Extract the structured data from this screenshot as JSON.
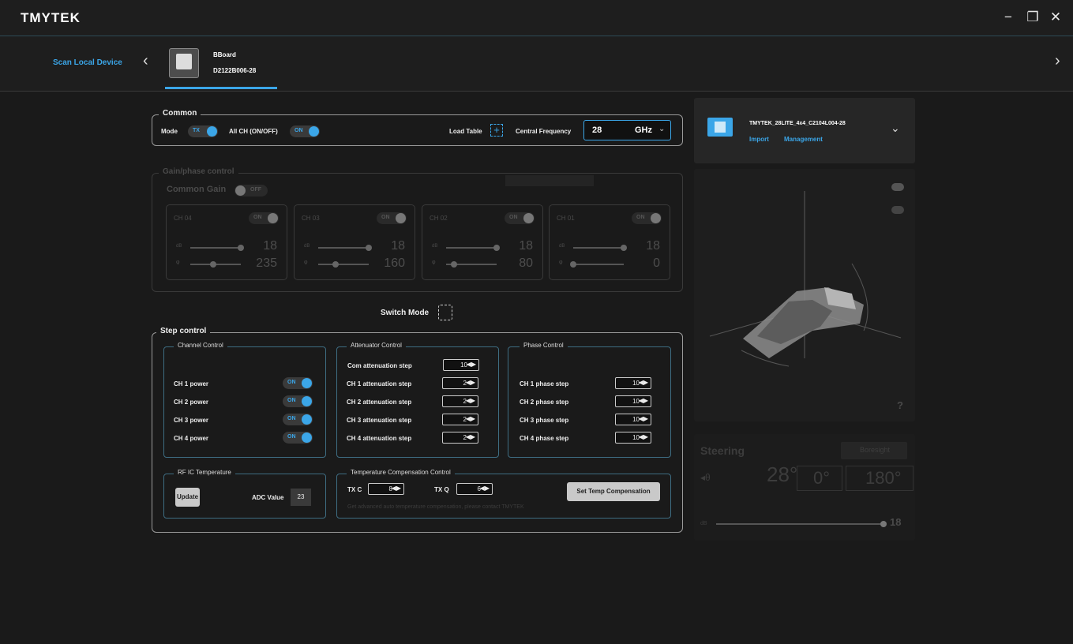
{
  "app": {
    "logo": "TMYTEK"
  },
  "window": {
    "minimize": "−",
    "restore": "❐",
    "close": "✕"
  },
  "devicebar": {
    "scan_label": "Scan Local Device",
    "device_name": "BBoard",
    "device_id": "D2122B006-28",
    "prev": "‹",
    "next": "›"
  },
  "common": {
    "legend": "Common",
    "mode_label": "Mode",
    "mode_value": "TX",
    "allch_label": "All CH (ON/OFF)",
    "allch_value": "ON",
    "load_table_label": "Load Table",
    "central_freq_label": "Central Frequency",
    "freq_value": "28",
    "freq_unit": "GHz"
  },
  "gainphase": {
    "legend": "Gain/phase control",
    "common_gain_label": "Common Gain",
    "common_gain_toggle": "OFF",
    "channels": [
      {
        "name": "CH 04",
        "toggle": "ON",
        "db_label": "dB",
        "db_value": "18",
        "phase_value": "235",
        "phase_level": 0.45
      },
      {
        "name": "CH 03",
        "toggle": "ON",
        "db_label": "dB",
        "db_value": "18",
        "phase_value": "160",
        "phase_level": 0.35
      },
      {
        "name": "CH 02",
        "toggle": "ON",
        "db_label": "dB",
        "db_value": "18",
        "phase_value": "80",
        "phase_level": 0.15
      },
      {
        "name": "CH 01",
        "toggle": "ON",
        "db_label": "dB",
        "db_value": "18",
        "phase_value": "0",
        "phase_level": 0.0
      }
    ]
  },
  "switch_mode_label": "Switch Mode",
  "step": {
    "legend": "Step control",
    "channel_control": {
      "legend": "Channel Control",
      "rows": [
        {
          "label": "CH 1 power",
          "value": "ON"
        },
        {
          "label": "CH 2 power",
          "value": "ON"
        },
        {
          "label": "CH 3 power",
          "value": "ON"
        },
        {
          "label": "CH 4 power",
          "value": "ON"
        }
      ]
    },
    "attenuator_control": {
      "legend": "Attenuator Control",
      "com_label": "Com attenuation step",
      "com_value": "10",
      "rows": [
        {
          "label": "CH 1 attenuation step",
          "value": "2"
        },
        {
          "label": "CH 2 attenuation step",
          "value": "2"
        },
        {
          "label": "CH 3 attenuation step",
          "value": "2"
        },
        {
          "label": "CH 4 attenuation step",
          "value": "2"
        }
      ]
    },
    "phase_control": {
      "legend": "Phase Control",
      "rows": [
        {
          "label": "CH 1 phase step",
          "value": "10"
        },
        {
          "label": "CH 2 phase step",
          "value": "10"
        },
        {
          "label": "CH 3 phase step",
          "value": "10"
        },
        {
          "label": "CH 4 phase step",
          "value": "10"
        }
      ]
    },
    "rfic": {
      "legend": "RF IC Temperature",
      "update_label": "Update",
      "adc_label": "ADC Value",
      "adc_value": "23"
    },
    "tempcomp": {
      "legend": "Temperature Compensation Control",
      "txc_label": "TX C",
      "txc_value": "8",
      "txq_label": "TX Q",
      "txq_value": "6",
      "set_label": "Set Temp Compensation",
      "note": "Get advanced auto temperature compensation, please contact TMYTEK"
    }
  },
  "right": {
    "device_title": "TMYTEK_28LITE_4x4_C2104L004-28",
    "import_label": "Import",
    "management_label": "Management",
    "help": "?"
  },
  "steering": {
    "title": "Steering",
    "boresight_label": "Boresight",
    "theta_value": "28°",
    "phi_value": "0°",
    "phi2_value": "180°",
    "db_label": "dB",
    "db_value": "18"
  },
  "colors": {
    "accent": "#3ba6e8",
    "background": "#1a1a1a"
  }
}
